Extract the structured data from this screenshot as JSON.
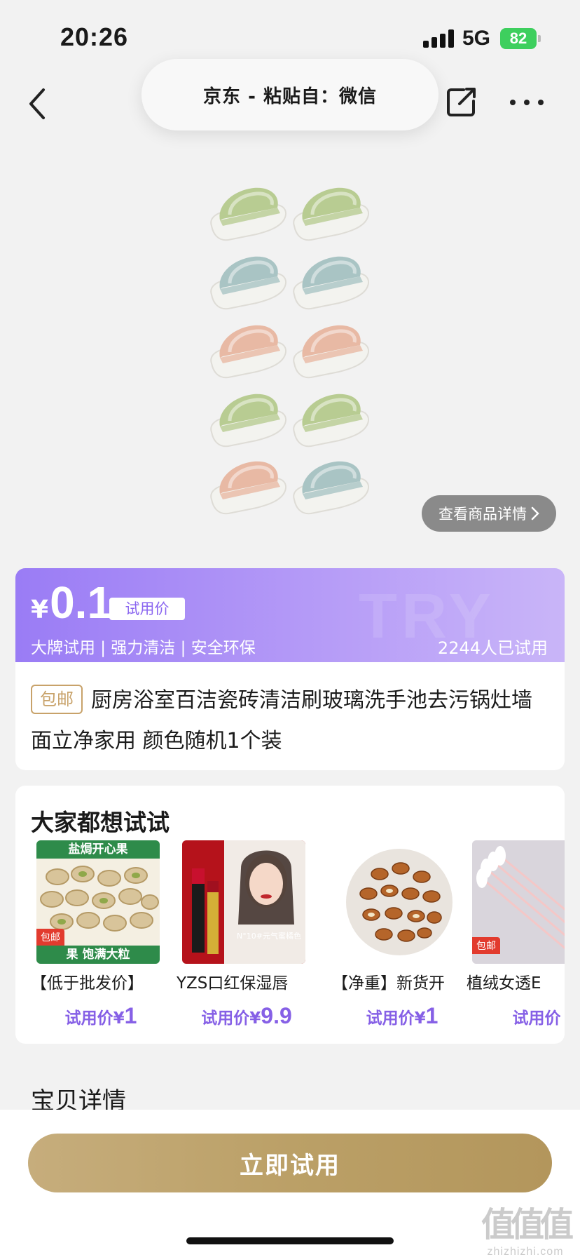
{
  "status_bar": {
    "time": "20:26",
    "network": "5G",
    "battery": "82"
  },
  "nav": {
    "title": "京东 - 粘贴自：微信",
    "back_icon": "chevron-left-icon",
    "share_icon": "share-icon",
    "more_icon": "more-dots-icon"
  },
  "product": {
    "image_label": "scrub-brushes-image",
    "detail_link": "查看商品详情",
    "currency": "¥",
    "price": "0.1",
    "price_tag": "试用价",
    "features": "大牌试用 | 强力清洁 | 安全环保",
    "tried_count": "2244人已试用",
    "shipping_badge": "包邮",
    "title": "厨房浴室百洁瓷砖清洁刷玻璃洗手池去污锅灶墙面立净家用 颜色随机1个装"
  },
  "recommendations": {
    "title": "大家都想试试",
    "items": [
      {
        "name": "【低于批发价】",
        "price_label": "试用价¥",
        "price": "1",
        "thumb_top": "盐焗开心果",
        "thumb_bottom": "果     饱满大粒",
        "badge": "包邮"
      },
      {
        "name": "YZS口红保湿唇",
        "price_label": "试用价¥",
        "price": "9.9",
        "thumb_text": "N°10#元气蜜橘色"
      },
      {
        "name": "【净重】新货开",
        "price_label": "试用价¥",
        "price": "1"
      },
      {
        "name": "植绒女透E",
        "price_label": "试用价",
        "price": "",
        "badge": "包邮"
      }
    ]
  },
  "section": {
    "detail_title": "宝贝详情"
  },
  "cta": {
    "label": "立即试用"
  },
  "watermark": {
    "mark": "值值值",
    "site": "zhizhizhi.com"
  },
  "colors": {
    "accent": "#9a7cf5",
    "cta": "#bba067",
    "badge": "#c8a26a",
    "price_text": "#8660e6"
  }
}
